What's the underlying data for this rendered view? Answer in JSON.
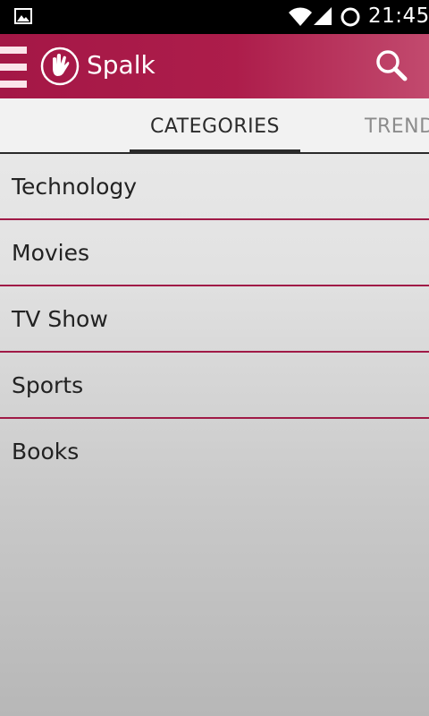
{
  "status_bar": {
    "time": "21:45",
    "icons": [
      "gallery-icon",
      "wifi-icon",
      "signal-icon",
      "sync-icon"
    ]
  },
  "app_bar": {
    "title": "Spalk",
    "icons": [
      "menu-icon",
      "hand-logo-icon",
      "search-icon"
    ],
    "background": "#a8194a"
  },
  "tabs": [
    {
      "label": "CATEGORIES",
      "selected": true
    },
    {
      "label": "TREND",
      "selected": false
    }
  ],
  "categories": [
    {
      "label": "Technology"
    },
    {
      "label": "Movies"
    },
    {
      "label": "TV Show"
    },
    {
      "label": "Sports"
    },
    {
      "label": "Books"
    }
  ],
  "colors": {
    "accent": "#a01a46",
    "tab_indicator": "#2a2a2a"
  }
}
